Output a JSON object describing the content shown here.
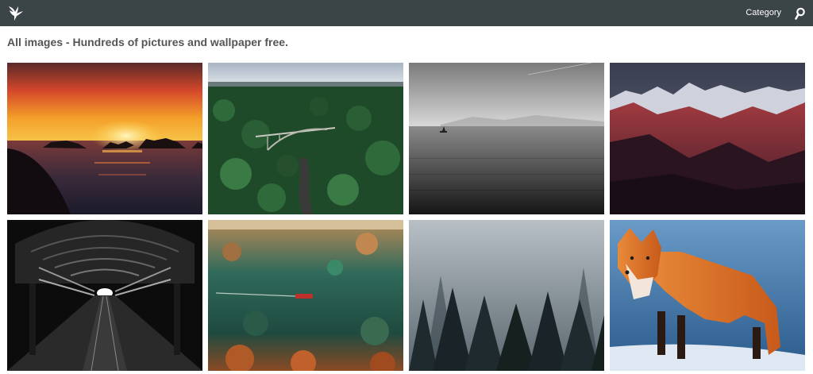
{
  "header": {
    "category_label": "Category",
    "logo_icon": "hummingbird-logo-icon",
    "search_icon": "search-icon",
    "bar_color": "#3b4447"
  },
  "main": {
    "title": "All images - Hundreds of pictures and wallpaper free."
  },
  "gallery": {
    "images": [
      {
        "subject": "sunset-over-sea"
      },
      {
        "subject": "bridge-over-forest"
      },
      {
        "subject": "misty-lake-with-boat"
      },
      {
        "subject": "red-mountain-range"
      },
      {
        "subject": "train-station-tunnel"
      },
      {
        "subject": "aerial-river-with-boat"
      },
      {
        "subject": "foggy-pine-forest"
      },
      {
        "subject": "red-fox"
      }
    ]
  }
}
